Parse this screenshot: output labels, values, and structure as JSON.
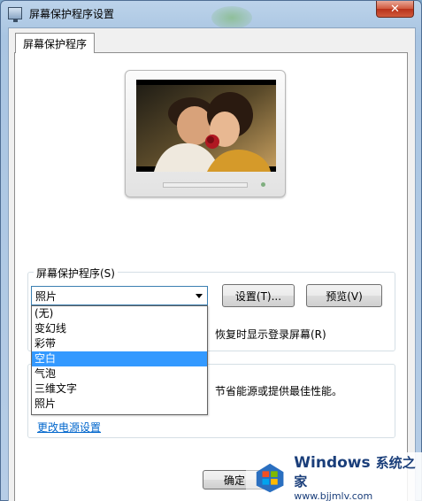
{
  "window": {
    "title": "屏幕保护程序设置",
    "close_glyph": "✕"
  },
  "tab": {
    "label": "屏幕保护程序"
  },
  "screensaver": {
    "group_label": "屏幕保护程序(S)",
    "selected_value": "照片",
    "settings_button": "设置(T)...",
    "preview_button": "预览(V)",
    "resume_text": "恢复时显示登录屏幕(R)",
    "options": [
      "(无)",
      "变幻线",
      "彩带",
      "空白",
      "气泡",
      "三维文字",
      "照片"
    ],
    "highlighted_option": "空白"
  },
  "power": {
    "partial_text": "节省能源或提供最佳性能。",
    "link": "更改电源设置"
  },
  "footer": {
    "ok_button": "确定"
  },
  "watermark": {
    "brand": "Windows",
    "brand_cn": "系统之家",
    "url": "www.bjjmlv.com"
  }
}
